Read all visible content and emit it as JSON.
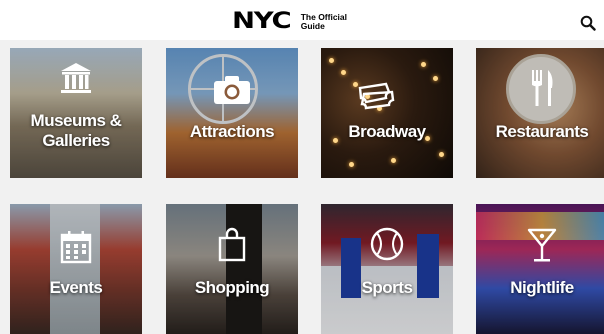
{
  "header": {
    "logo_mark": "NYC",
    "logo_line1": "The Official",
    "logo_line2": "Guide"
  },
  "icons": {
    "search": "search-icon"
  },
  "tiles": [
    {
      "key": "museums",
      "line1": "Museums &",
      "line2": "Galleries",
      "icon": "museum-icon"
    },
    {
      "key": "attractions",
      "line1": "Attractions",
      "line2": "",
      "icon": "camera-icon"
    },
    {
      "key": "broadway",
      "line1": "Broadway",
      "line2": "",
      "icon": "ticket-icon"
    },
    {
      "key": "restaurants",
      "line1": "Restaurants",
      "line2": "",
      "icon": "fork-knife-icon"
    },
    {
      "key": "events",
      "line1": "Events",
      "line2": "",
      "icon": "calendar-icon"
    },
    {
      "key": "shopping",
      "line1": "Shopping",
      "line2": "",
      "icon": "shopping-bag-icon"
    },
    {
      "key": "sports",
      "line1": "Sports",
      "line2": "",
      "icon": "baseball-icon"
    },
    {
      "key": "nightlife",
      "line1": "Nightlife",
      "line2": "",
      "icon": "cocktail-icon"
    }
  ]
}
